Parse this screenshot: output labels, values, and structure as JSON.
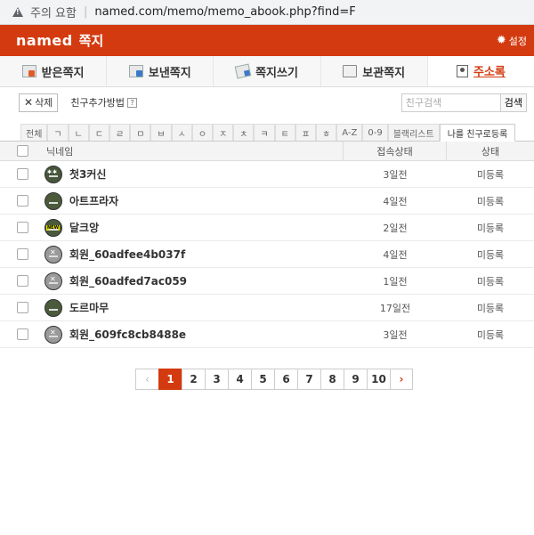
{
  "address_bar": {
    "warning": "주의 요함",
    "url": "named.com/memo/memo_abook.php?find=F"
  },
  "header": {
    "logo": "named",
    "title": "쪽지",
    "settings_label": "설정"
  },
  "tabs": [
    {
      "label": "받은쪽지",
      "icon": "inbox-icon"
    },
    {
      "label": "보낸쪽지",
      "icon": "sent-icon"
    },
    {
      "label": "쪽지쓰기",
      "icon": "compose-icon"
    },
    {
      "label": "보관쪽지",
      "icon": "folder-icon"
    },
    {
      "label": "주소록",
      "icon": "address-book-icon"
    }
  ],
  "toolbar": {
    "delete_label": "삭제",
    "add_friend_help": "친구추가방법",
    "help_icon": "?",
    "search_placeholder": "친구검색",
    "search_button": "검색"
  },
  "index_filter": [
    "전체",
    "ㄱ",
    "ㄴ",
    "ㄷ",
    "ㄹ",
    "ㅁ",
    "ㅂ",
    "ㅅ",
    "ㅇ",
    "ㅈ",
    "ㅊ",
    "ㅋ",
    "ㅌ",
    "ㅍ",
    "ㅎ",
    "A-Z",
    "0-9",
    "블랙리스트",
    "나를 친구로등록"
  ],
  "table": {
    "headers": {
      "nickname": "닉네임",
      "connection": "접속상태",
      "status": "상태"
    },
    "rows": [
      {
        "nickname": "첫3커신",
        "connection": "3일전",
        "status": "미등록",
        "avatar": "star"
      },
      {
        "nickname": "아트프라자",
        "connection": "4일전",
        "status": "미등록",
        "avatar": "plain"
      },
      {
        "nickname": "달크앙",
        "connection": "2일전",
        "status": "미등록",
        "avatar": "newb"
      },
      {
        "nickname": "회원_60adfee4b037f",
        "connection": "4일전",
        "status": "미등록",
        "avatar": "grey"
      },
      {
        "nickname": "회원_60adfed7ac059",
        "connection": "1일전",
        "status": "미등록",
        "avatar": "grey"
      },
      {
        "nickname": "도르마무",
        "connection": "17일전",
        "status": "미등록",
        "avatar": "plain"
      },
      {
        "nickname": "회원_609fc8cb8488e",
        "connection": "3일전",
        "status": "미등록",
        "avatar": "grey"
      }
    ]
  },
  "pagination": {
    "prev": "‹",
    "pages": [
      "1",
      "2",
      "3",
      "4",
      "5",
      "6",
      "7",
      "8",
      "9",
      "10"
    ],
    "current": "1",
    "next": "›"
  },
  "colors": {
    "accent": "#d43a0f"
  }
}
